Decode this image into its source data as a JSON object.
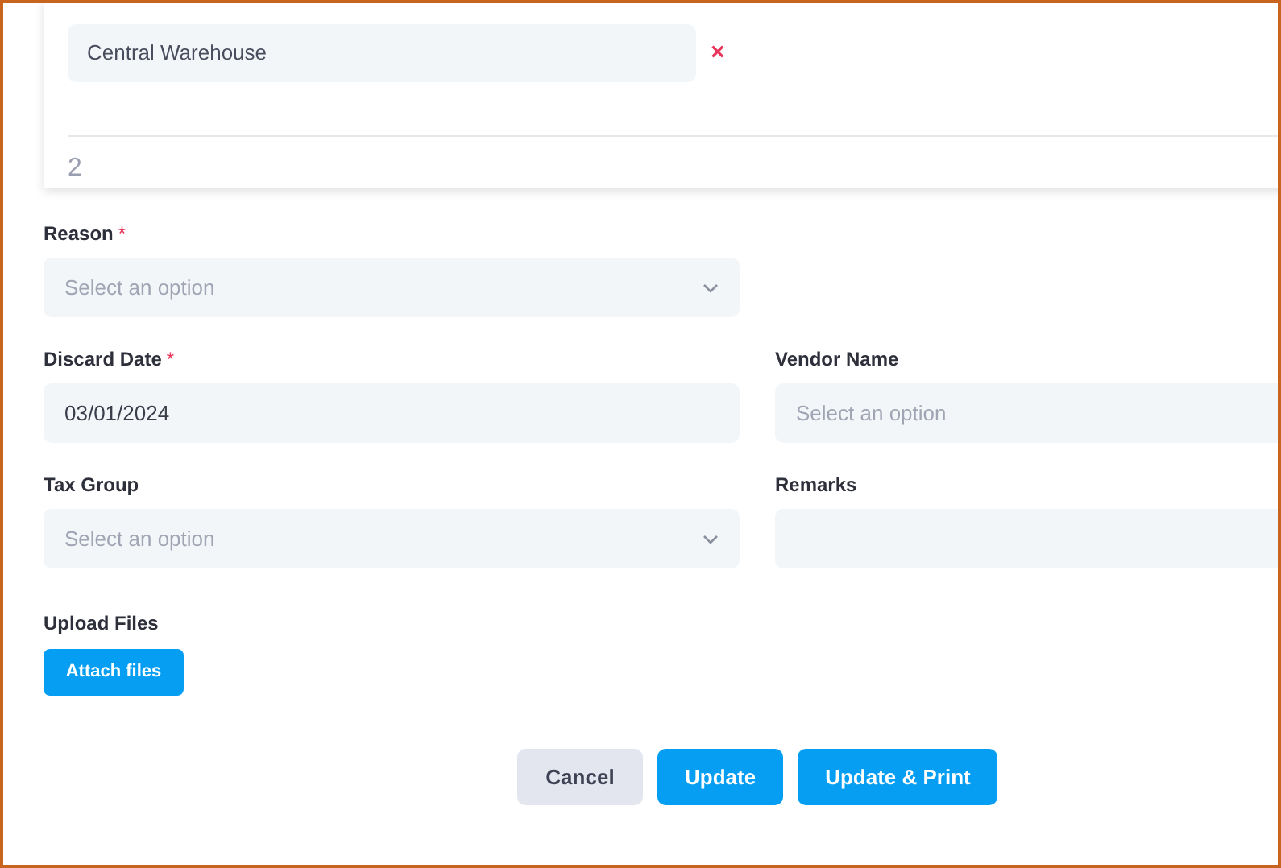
{
  "location_card": {
    "location_field": {
      "value": "Central Warehouse"
    },
    "remove_mark": "×",
    "row_number": "2"
  },
  "form_rows": [
    [
      {
        "label": "Reason",
        "required_mark": "*",
        "kind": "select",
        "placeholder": "Select an option"
      }
    ],
    [
      {
        "label": "Discard Date",
        "required_mark": "*",
        "kind": "text",
        "value": "03/01/2024"
      },
      {
        "label": "Vendor Name",
        "kind": "text",
        "placeholder": "Select an option"
      }
    ],
    [
      {
        "label": "Tax Group",
        "kind": "select",
        "placeholder": "Select an option"
      },
      {
        "label": "Remarks",
        "kind": "text"
      }
    ]
  ],
  "upload": {
    "label": "Upload Files",
    "button": "Attach files"
  },
  "actions": [
    {
      "label": "Cancel",
      "kind": "secondary"
    },
    {
      "label": "Update",
      "kind": "primary"
    },
    {
      "label": "Update & Print",
      "kind": "primary"
    }
  ]
}
